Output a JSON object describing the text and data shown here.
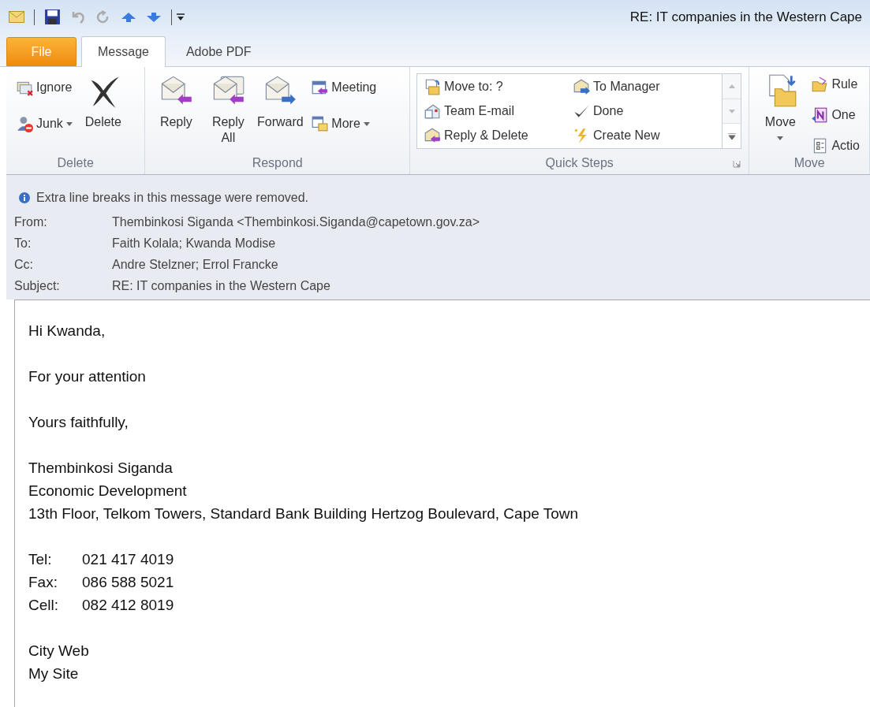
{
  "window": {
    "title": "RE: IT companies in the Western Cape"
  },
  "tabs": [
    {
      "label": "File",
      "kind": "file",
      "selected": false
    },
    {
      "label": "Message",
      "kind": "tab",
      "selected": true
    },
    {
      "label": "Adobe PDF",
      "kind": "tab",
      "selected": false
    }
  ],
  "ribbon": {
    "groups": [
      {
        "label": "Delete",
        "kind": "buttons",
        "columns": [
          [
            {
              "label": "Ignore",
              "kind": "small",
              "dropdown": false
            },
            {
              "label": "Junk",
              "kind": "small",
              "dropdown": true
            }
          ],
          [
            {
              "label": "Delete",
              "kind": "large",
              "dropdown": false
            }
          ]
        ]
      },
      {
        "label": "Respond",
        "kind": "buttons",
        "columns": [
          [
            {
              "label": "Reply",
              "kind": "large",
              "dropdown": false
            }
          ],
          [
            {
              "label": "Reply All",
              "kind": "large",
              "dropdown": false
            }
          ],
          [
            {
              "label": "Forward",
              "kind": "large",
              "dropdown": false
            }
          ],
          [
            {
              "label": "Meeting",
              "kind": "small",
              "dropdown": false
            },
            {
              "label": "More",
              "kind": "small",
              "dropdown": true
            }
          ]
        ]
      },
      {
        "label": "Quick Steps",
        "kind": "gallery",
        "columns": [
          [
            {
              "label": "Move to: ?",
              "kind": "small",
              "dropdown": false
            },
            {
              "label": "Team E-mail",
              "kind": "small",
              "dropdown": false
            },
            {
              "label": "Reply & Delete",
              "kind": "small",
              "dropdown": false
            }
          ],
          [
            {
              "label": "To Manager",
              "kind": "small",
              "dropdown": false
            },
            {
              "label": "Done",
              "kind": "small",
              "dropdown": false
            },
            {
              "label": "Create New",
              "kind": "small",
              "dropdown": false
            }
          ]
        ]
      },
      {
        "label": "Move",
        "kind": "buttons",
        "columns": [
          [
            {
              "label": "Move",
              "kind": "large",
              "dropdown": true
            }
          ],
          [
            {
              "label": "Rule",
              "kind": "small",
              "dropdown": false
            },
            {
              "label": "One",
              "kind": "small",
              "dropdown": false
            },
            {
              "label": "Actio",
              "kind": "small",
              "dropdown": false
            }
          ]
        ]
      }
    ]
  },
  "notice": "Extra line breaks in this message were removed.",
  "header": [
    {
      "label": "From:",
      "value": "Thembinkosi Siganda <Thembinkosi.Siganda@capetown.gov.za>"
    },
    {
      "label": "To:",
      "value": "Faith Kolala; Kwanda Modise"
    },
    {
      "label": "Cc:",
      "value": "Andre Stelzner; Errol Francke"
    },
    {
      "label": "Subject:",
      "value": "RE: IT companies in the Western Cape"
    }
  ],
  "body": [
    {
      "kind": "lines",
      "lines": [
        "Hi Kwanda,"
      ]
    },
    {
      "kind": "lines",
      "lines": [
        "For your attention"
      ]
    },
    {
      "kind": "lines",
      "lines": [
        "Yours faithfully,"
      ]
    },
    {
      "kind": "lines",
      "lines": [
        "Thembinkosi Siganda",
        "Economic Development",
        "13th Floor, Telkom Towers, Standard Bank Building Hertzog Boulevard, Cape Town"
      ]
    },
    {
      "kind": "contacts",
      "contacts": [
        {
          "label": "Tel:",
          "value": "021 417 4019"
        },
        {
          "label": "Fax:",
          "value": "086 588 5021"
        },
        {
          "label": "Cell:",
          "value": "082 412 8019"
        }
      ]
    },
    {
      "kind": "lines",
      "lines": [
        "City Web",
        "My Site"
      ]
    }
  ]
}
